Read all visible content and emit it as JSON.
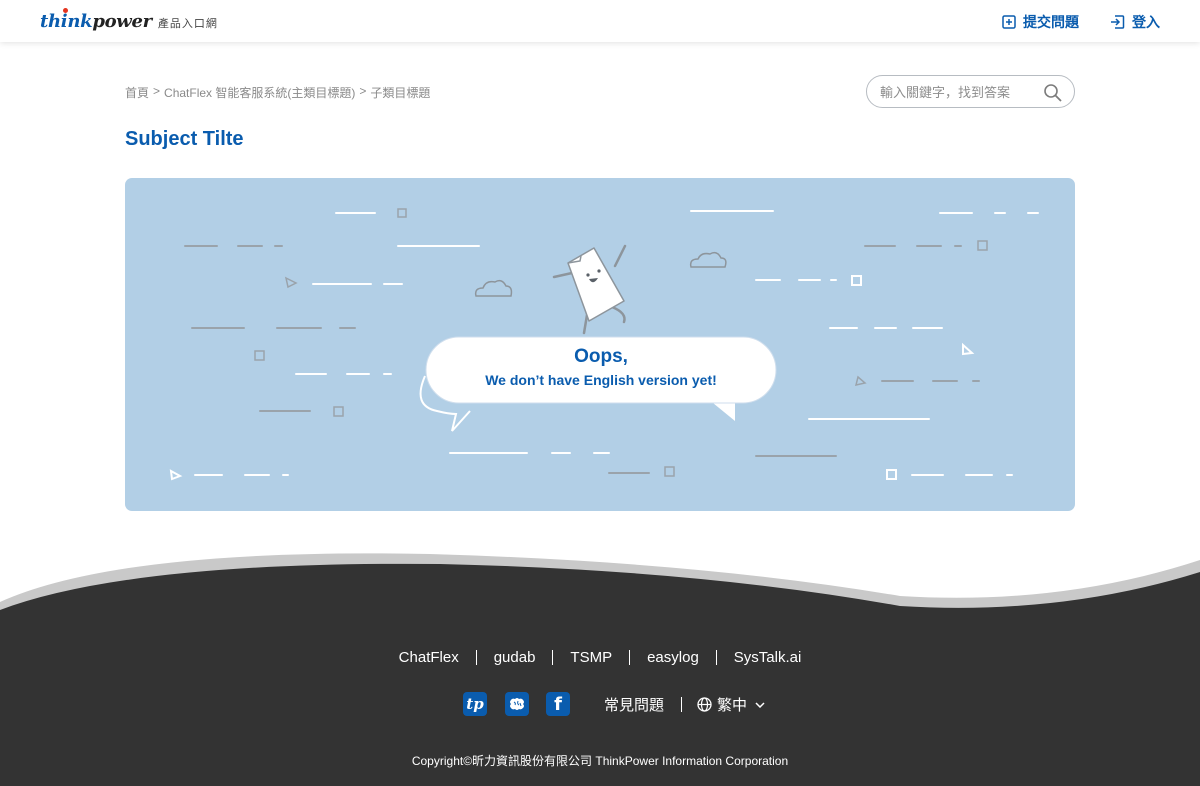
{
  "header": {
    "logo_think": "think",
    "logo_power": "power",
    "logo_sub": "產品入口網",
    "submit_label": "提交問題",
    "login_label": "登入"
  },
  "breadcrumb": {
    "home": "首頁",
    "sep": ">",
    "category": "ChatFlex 智能客服系統(主類目標題)",
    "subcategory": "子類目標題"
  },
  "search": {
    "placeholder": "輸入關鍵字，找到答案"
  },
  "page": {
    "title": "Subject Tilte"
  },
  "banner": {
    "heading": "Oops,",
    "message": "We don’t have English version yet!"
  },
  "footer": {
    "links": [
      "ChatFlex",
      "gudab",
      "TSMP",
      "easylog",
      "SysTalk.ai"
    ],
    "social_tp": "tp",
    "social_fb": "f",
    "faq": "常見問題",
    "language": "繁中",
    "copyright": "Copyright©昕力資訊股份有限公司 ThinkPower Information Corporation"
  },
  "colors": {
    "brand_blue": "#0a5cae",
    "banner_bg": "#b2cfe6",
    "footer_bg": "#333333",
    "logo_dot": "#e4341f"
  },
  "icons": {
    "submit": "plus-square-icon",
    "login": "login-arrow-icon",
    "search": "search-icon",
    "language": "globe-icon",
    "dropdown": "chevron-down-icon",
    "social": [
      "thinkpower-tp-icon",
      "brain-icon",
      "facebook-icon"
    ]
  }
}
